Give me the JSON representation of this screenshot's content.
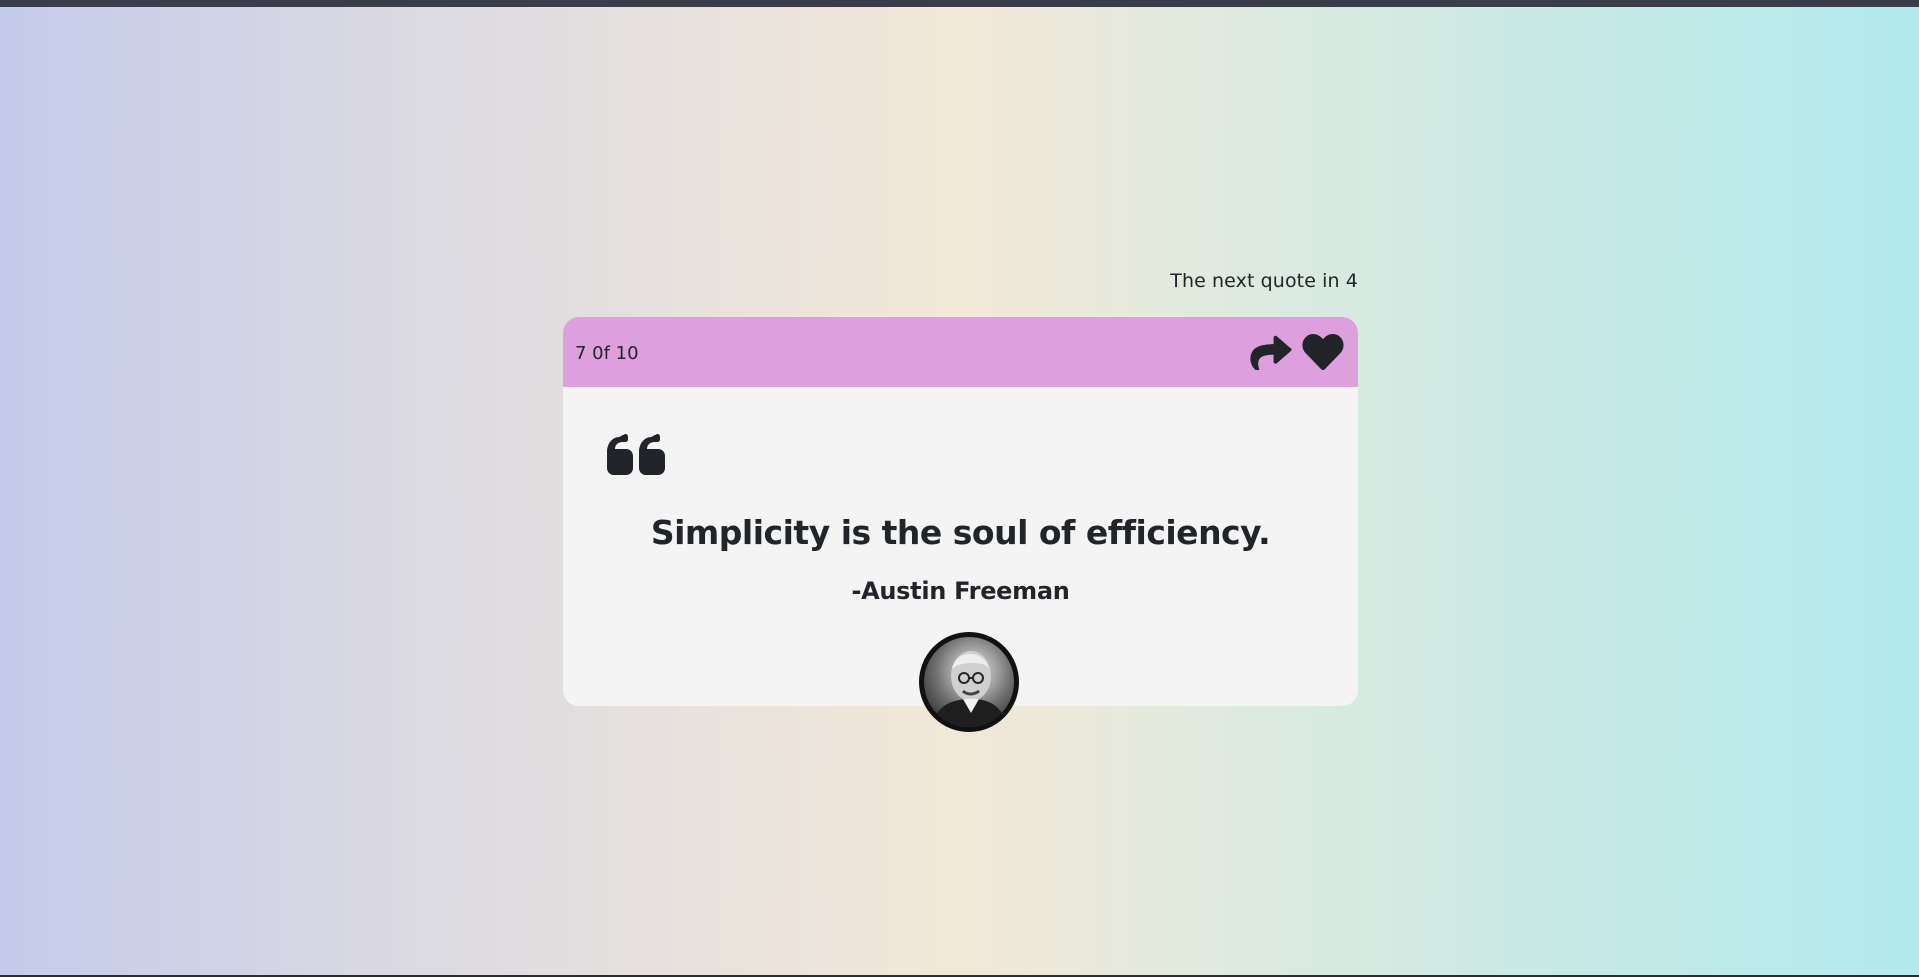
{
  "countdown": {
    "text": "The next quote in 4"
  },
  "card": {
    "counter": "7 0f 10",
    "actions": {
      "share_icon": "share-icon",
      "like_icon": "heart-icon"
    },
    "quote_icon": "quote-left-icon",
    "quote": "Simplicity is the soul of efficiency.",
    "author": "-Austin Freeman"
  },
  "colors": {
    "header": "#dd9fdd",
    "card": "#f4f4f4",
    "text": "#212529"
  }
}
